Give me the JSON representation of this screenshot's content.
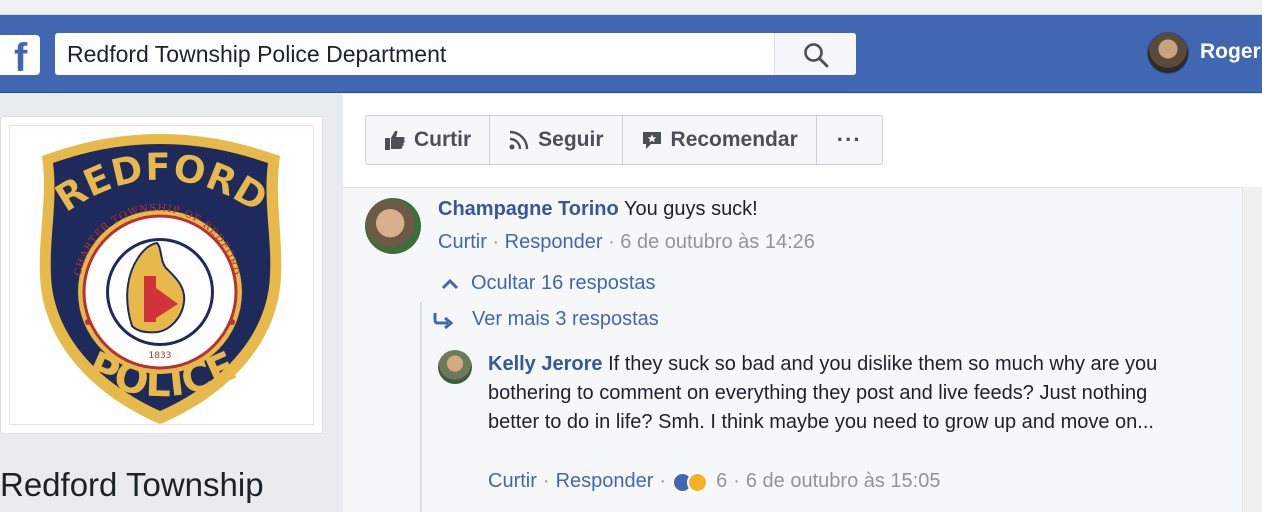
{
  "search": {
    "value": "Redford Township Police Department"
  },
  "user": {
    "name": "Roger"
  },
  "page": {
    "name": "Redford Township"
  },
  "logo": {
    "top_text": "REDFORD",
    "ring_text": "CHARTER TOWNSHIP OF REDFORD",
    "year": "1833",
    "bottom_text": "POLICE"
  },
  "actions": [
    {
      "label": "Curtir",
      "icon": "thumbs-up-icon"
    },
    {
      "label": "Seguir",
      "icon": "rss-icon"
    },
    {
      "label": "Recomendar",
      "icon": "recommend-icon"
    },
    {
      "label": "···",
      "icon": "more-icon"
    }
  ],
  "comment1": {
    "author": "Champagne Torino",
    "text": "You guys suck!",
    "like": "Curtir",
    "reply": "Responder",
    "time": "6 de outubro às 14:26"
  },
  "replies": {
    "hide": "Ocultar 16 respostas",
    "more": "Ver mais 3 respostas"
  },
  "comment2": {
    "author": "Kelly Jerore",
    "text": "If they suck so bad and you dislike them so much why are you bothering to comment on everything they post and live feeds? Just nothing better to do in life? Smh. I think maybe you need to grow up and move on...",
    "like": "Curtir",
    "reply": "Responder",
    "reaction_count": "6",
    "time": "6 de outubro às 15:05"
  },
  "colors": {
    "brand": "#4267b2",
    "link": "#365899",
    "meta": "#90949c",
    "badge_navy": "#1f2a5c",
    "badge_gold": "#e7b84a"
  }
}
